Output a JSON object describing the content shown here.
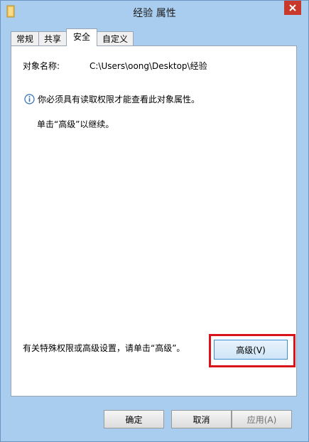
{
  "window": {
    "title": "经验 属性",
    "close_icon": "close-icon",
    "folder_icon": "folder-icon"
  },
  "tabs": [
    {
      "label": "常规"
    },
    {
      "label": "共享"
    },
    {
      "label": "安全",
      "active": true
    },
    {
      "label": "自定义"
    }
  ],
  "security": {
    "object_name_label": "对象名称:",
    "object_name_value": "C:\\Users\\oong\\Desktop\\经验",
    "info_message": "你必须具有读取权限才能查看此对象属性。",
    "continue_message": "单击“高级”以继续。",
    "special_permissions_message": "有关特殊权限或高级设置，请单击“高级”。",
    "advanced_button": "高级(V)",
    "highlight_color": "#d9141b"
  },
  "footer": {
    "ok_label": "确定",
    "cancel_label": "取消",
    "apply_label": "应用(A)"
  }
}
